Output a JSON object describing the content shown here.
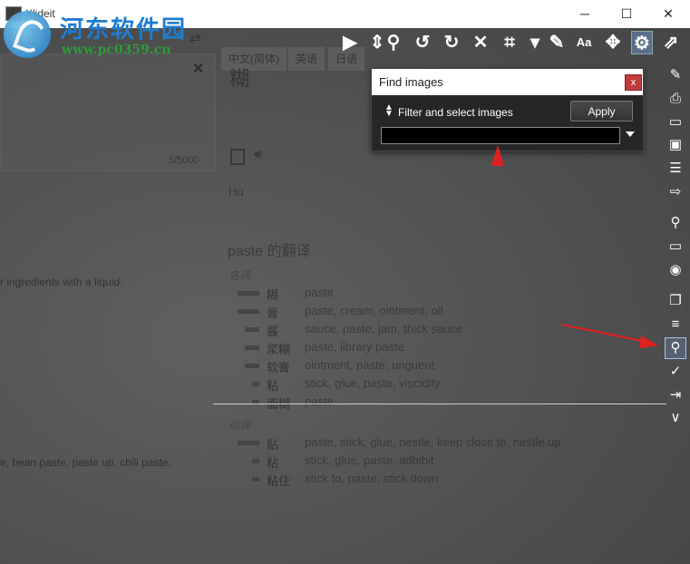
{
  "window": {
    "title": "Xlideit",
    "minimize": "─",
    "maximize": "☐",
    "close": "✕"
  },
  "watermark": {
    "title": "河东软件园",
    "url": "www.pc0359.cn"
  },
  "background_page": {
    "lang_tabs": [
      "中文(简体)",
      "英语",
      "日语"
    ],
    "input_close": "✕",
    "char_count": "5/5000",
    "result_char": "糊",
    "pinyin": "Hú",
    "translations_heading": "paste 的翻译",
    "def_partial_1": "r ingredients with a liquid.",
    "def_partial_2": "e, bean paste, paste up, chili paste,",
    "noun_label": "名词",
    "verb_label": "动词",
    "noun_rows": [
      {
        "zh": "糊",
        "en": "paste",
        "freq": 3
      },
      {
        "zh": "膏",
        "en": "paste, cream, ointment, oil",
        "freq": 3
      },
      {
        "zh": "酱",
        "en": "sauce, paste, jam, thick sauce",
        "freq": 2
      },
      {
        "zh": "浆糊",
        "en": "paste, library paste",
        "freq": 2
      },
      {
        "zh": "软膏",
        "en": "ointment, paste, unguent",
        "freq": 2
      },
      {
        "zh": "粘",
        "en": "stick, glue, paste, viscidity",
        "freq": 1
      },
      {
        "zh": "面糊",
        "en": "paste",
        "freq": 1
      }
    ],
    "verb_rows": [
      {
        "zh": "贴",
        "en": "paste, stick, glue, nestle, keep close to, nestle up",
        "freq": 3
      },
      {
        "zh": "粘",
        "en": "stick, glue, paste, adhibit",
        "freq": 1
      },
      {
        "zh": "粘住",
        "en": "stick to, paste, stick down",
        "freq": 1
      }
    ]
  },
  "toolbar": {
    "buttons": [
      {
        "name": "play-icon",
        "glyph": "▶"
      },
      {
        "name": "up-down-icon",
        "glyph": "⇕"
      },
      {
        "name": "search-icon",
        "glyph": "⚲"
      },
      {
        "name": "rotate-left-icon",
        "glyph": "↺"
      },
      {
        "name": "rotate-right-icon",
        "glyph": "↻"
      },
      {
        "name": "close-icon",
        "glyph": "✕"
      },
      {
        "name": "crop-icon",
        "glyph": "⌗"
      },
      {
        "name": "dropdown-icon",
        "glyph": "▾"
      },
      {
        "name": "edit-icon",
        "glyph": "✎"
      },
      {
        "name": "text-size-icon",
        "glyph": "Aa"
      },
      {
        "name": "move-icon",
        "glyph": "✥"
      },
      {
        "name": "settings-icon",
        "glyph": "⚙"
      },
      {
        "name": "external-link-icon",
        "glyph": "⇗"
      }
    ]
  },
  "sidebar": {
    "buttons": [
      {
        "name": "edit-file-icon",
        "glyph": "✎"
      },
      {
        "name": "print-icon",
        "glyph": "⎙"
      },
      {
        "name": "laptop-icon",
        "glyph": "▭"
      },
      {
        "name": "image-icon",
        "glyph": "▣"
      },
      {
        "name": "list-icon",
        "glyph": "☰"
      },
      {
        "name": "folder-move-icon",
        "glyph": "⇨"
      },
      {
        "name": "find-file-icon",
        "glyph": "⚲"
      },
      {
        "name": "folder-icon",
        "glyph": "▭"
      },
      {
        "name": "camera-icon",
        "glyph": "◉"
      },
      {
        "name": "folder-copy-icon",
        "glyph": "❐"
      },
      {
        "name": "document-list-icon",
        "glyph": "≡"
      },
      {
        "name": "find-images-icon",
        "glyph": "⚲"
      },
      {
        "name": "checkbox-icon",
        "glyph": "✓"
      },
      {
        "name": "exit-icon",
        "glyph": "⇥"
      },
      {
        "name": "chevron-down-icon",
        "glyph": "∨"
      }
    ]
  },
  "find_dialog": {
    "title": "Find images",
    "close": "x",
    "filter_label": "Filter and select images",
    "apply_label": "Apply",
    "filter_value": ""
  },
  "colors": {
    "dialog_close": "#c43a3a",
    "annotation_arrow": "#e02020",
    "active_highlight": "#9fc7ee"
  }
}
